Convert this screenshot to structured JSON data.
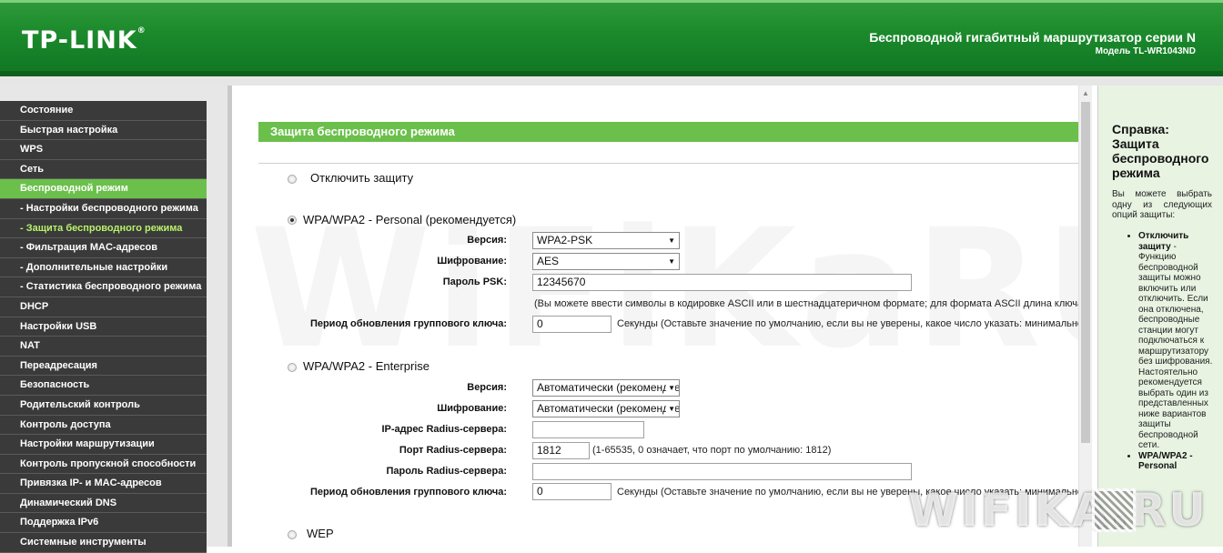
{
  "header": {
    "logo": "TP-LINK",
    "logo_mark": "®",
    "product_title": "Беспроводной гигабитный маршрутизатор серии N",
    "model": "Модель TL-WR1043ND"
  },
  "sidebar": {
    "items": [
      {
        "label": "Состояние"
      },
      {
        "label": "Быстрая настройка"
      },
      {
        "label": "WPS"
      },
      {
        "label": "Сеть"
      },
      {
        "label": "Беспроводной режим",
        "state": "active"
      },
      {
        "label": "- Настройки беспроводного режима"
      },
      {
        "label": "- Защита беспроводного режима",
        "state": "current"
      },
      {
        "label": "- Фильтрация MAC-адресов"
      },
      {
        "label": "- Дополнительные настройки"
      },
      {
        "label": "- Статистика беспроводного режима"
      },
      {
        "label": "DHCP"
      },
      {
        "label": "Настройки USB"
      },
      {
        "label": "NAT"
      },
      {
        "label": "Переадресация"
      },
      {
        "label": "Безопасность"
      },
      {
        "label": "Родительский контроль"
      },
      {
        "label": "Контроль доступа"
      },
      {
        "label": "Настройки маршрутизации"
      },
      {
        "label": "Контроль пропускной способности"
      },
      {
        "label": "Привязка IP- и MAC-адресов"
      },
      {
        "label": "Динамический DNS"
      },
      {
        "label": "Поддержка IPv6"
      },
      {
        "label": "Системные инструменты"
      }
    ]
  },
  "main": {
    "section_title": "Защита беспроводного режима",
    "disable": {
      "label": "Отключить защиту",
      "selected": false
    },
    "personal": {
      "label": "WPA/WPA2 - Personal (рекомендуется)",
      "selected": true,
      "version_label": "Версия:",
      "version_value": "WPA2-PSK",
      "encryption_label": "Шифрование:",
      "encryption_value": "AES",
      "psk_label": "Пароль PSK:",
      "psk_value": "12345670",
      "psk_note": "(Вы можете ввести символы в кодировке ASCII или в шестнадцатеричном формате; для формата ASCII длина ключа д",
      "group_label": "Период обновления группового ключа:",
      "group_value": "0",
      "group_note": "Секунды (Оставьте значение по умолчанию, если вы не уверены, какое число указать: минимально"
    },
    "enterprise": {
      "label": "WPA/WPA2 - Enterprise",
      "selected": false,
      "version_label": "Версия:",
      "version_value": "Автоматически (рекомендуется)",
      "encryption_label": "Шифрование:",
      "encryption_value": "Автоматически (рекомендуется)",
      "radius_ip_label": "IP-адрес Radius-сервера:",
      "radius_ip_value": "",
      "radius_port_label": "Порт Radius-сервера:",
      "radius_port_value": "1812",
      "radius_port_note": "(1-65535, 0 означает, что порт по умолчанию: 1812)",
      "radius_pass_label": "Пароль Radius-сервера:",
      "radius_pass_value": "",
      "group_label": "Период обновления группового ключа:",
      "group_value": "0",
      "group_note": "Секунды (Оставьте значение по умолчанию, если вы не уверены, какое число указать: минимально"
    },
    "wep": {
      "label": "WEP",
      "selected": false
    }
  },
  "help": {
    "title": "Справка: Защита беспроводного режима",
    "intro": "Вы можете выбрать одну из следующих опций защиты:",
    "items": [
      {
        "term": "Отключить защиту",
        "text": " - Функцию беспроводной защиты можно включить или отключить. Если она отключена, беспроводные станции могут подключаться к маршрутизатору без шифрования. Настоятельно рекомендуется выбрать один из представленных ниже вариантов защиты беспроводной сети."
      },
      {
        "term": "WPA/WPA2 - Personal",
        "text": ""
      }
    ]
  },
  "watermark": {
    "text": "WiFiKaRU",
    "logo": "WIFIKA.RU"
  }
}
